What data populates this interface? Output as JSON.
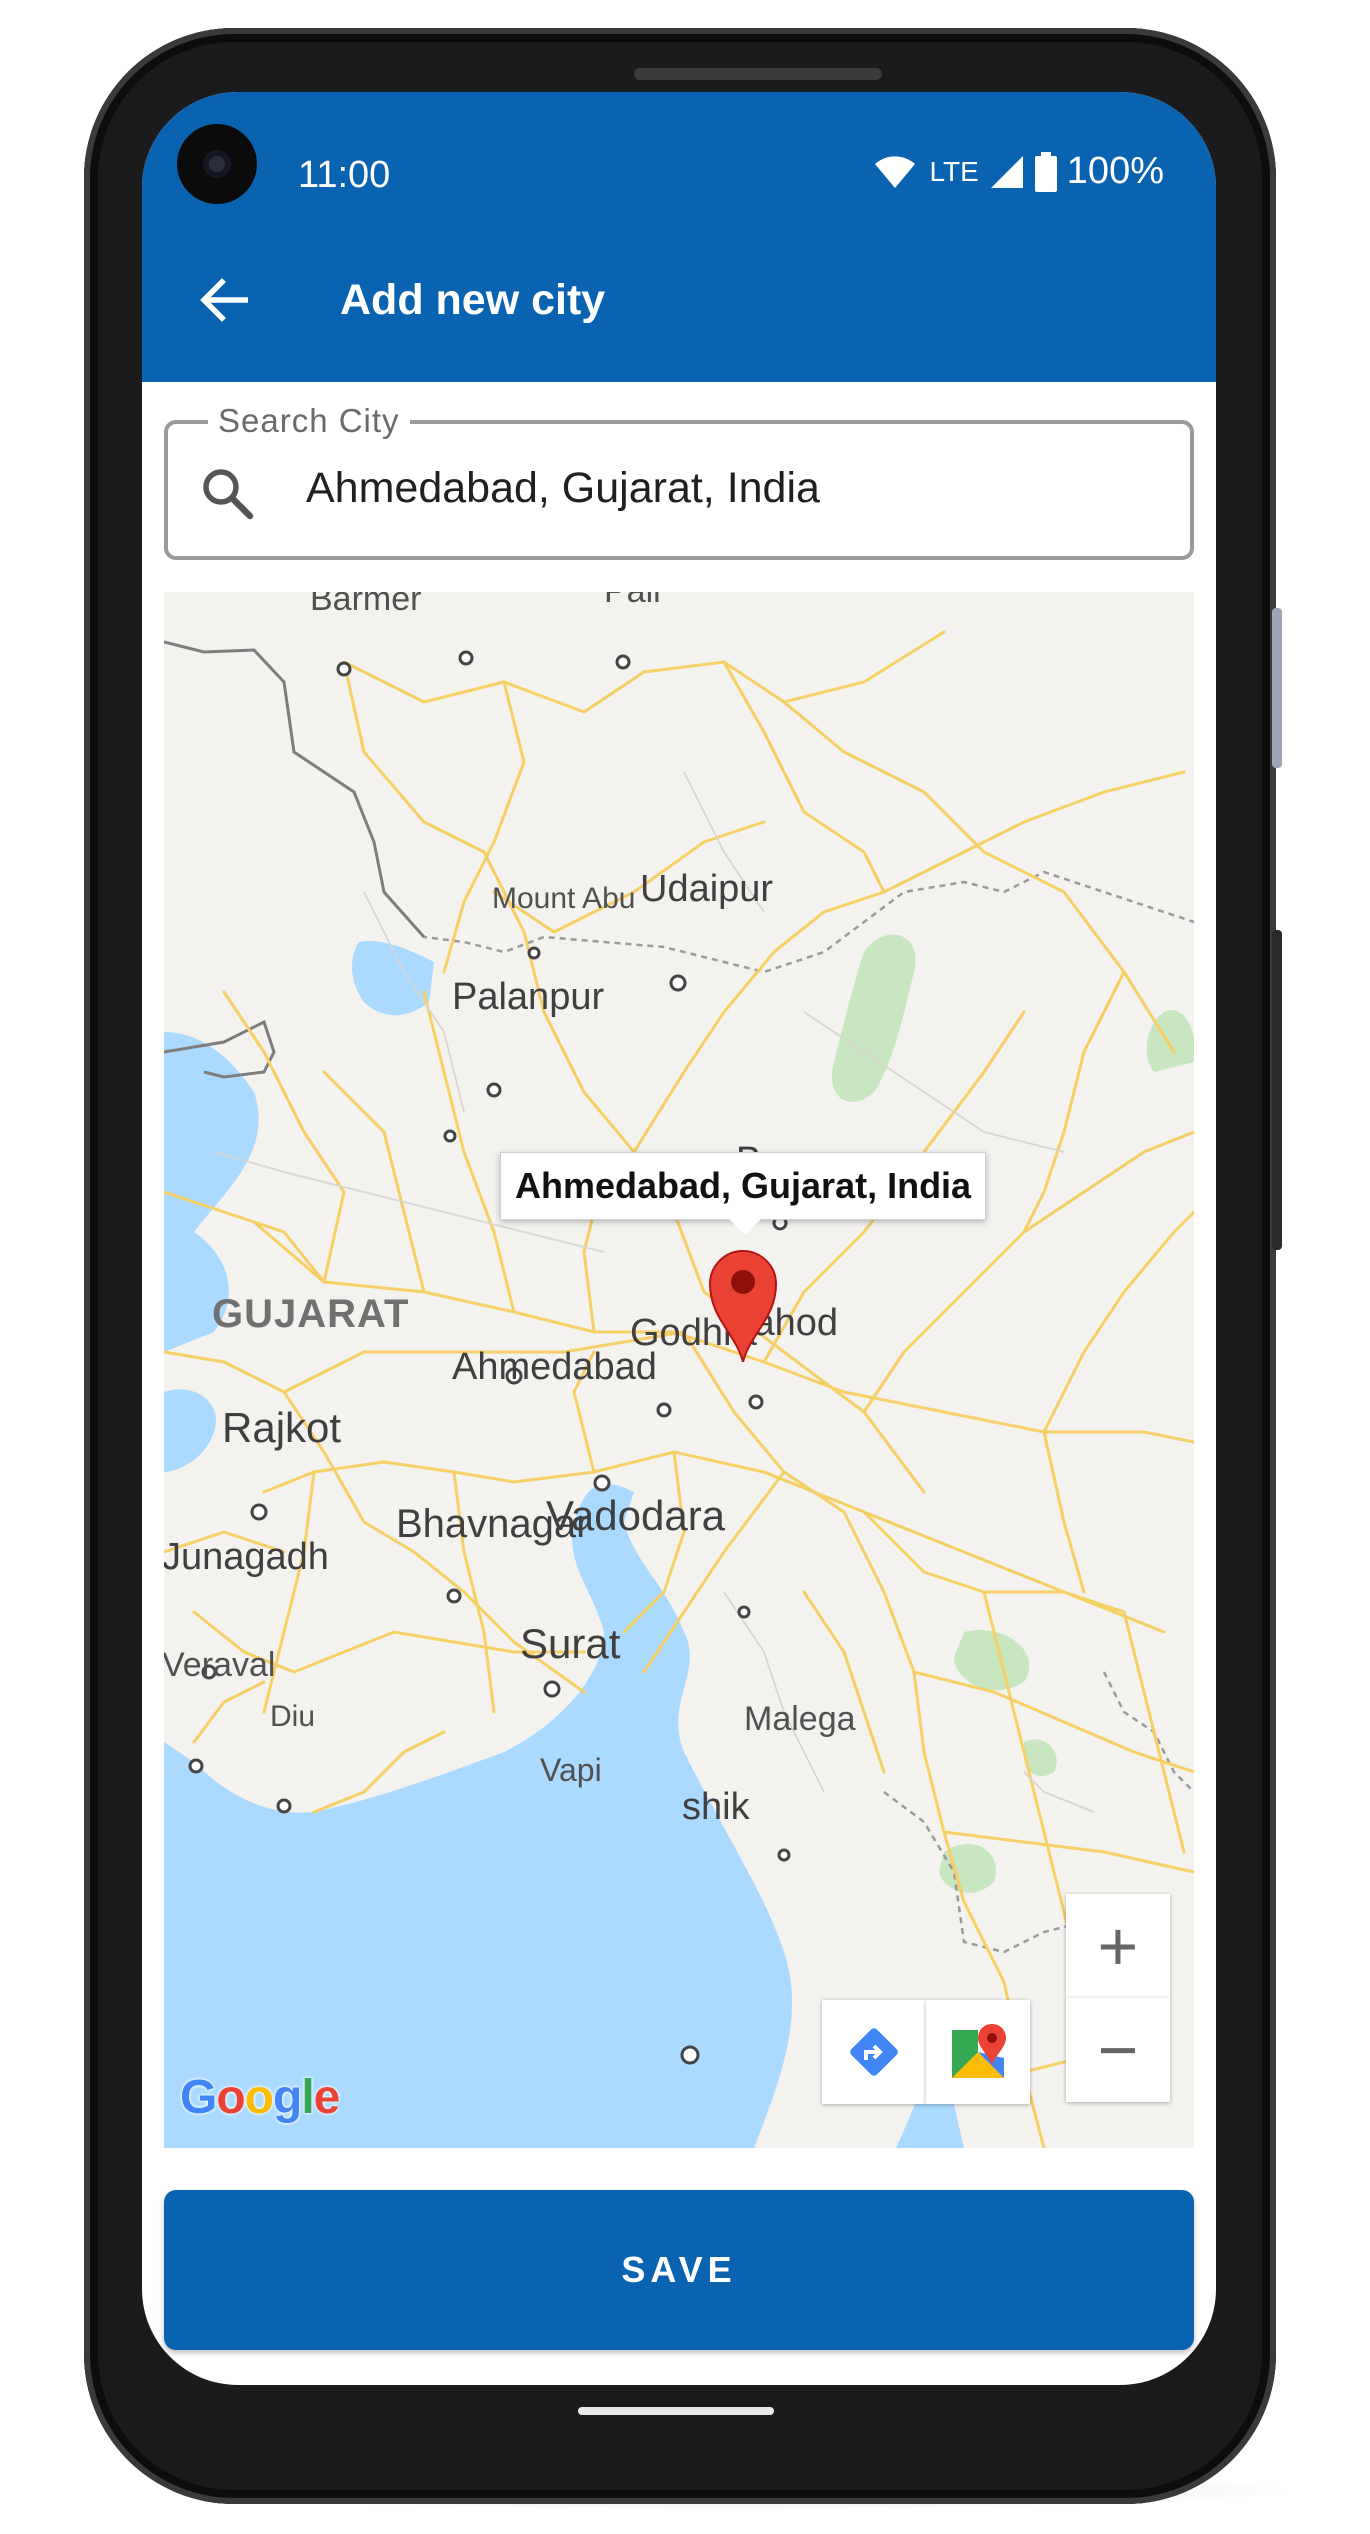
{
  "status_bar": {
    "time": "11:00",
    "network": "LTE",
    "battery": "100%"
  },
  "app_bar": {
    "title": "Add new city",
    "back_icon": "arrow-back-icon"
  },
  "search": {
    "label": "Search City",
    "value": "Ahmedabad, Gujarat, India",
    "icon": "search-icon"
  },
  "map": {
    "selected_place": "Ahmedabad, Gujarat, India",
    "attribution": "Google",
    "zoom_in_label": "+",
    "zoom_out_label": "−",
    "labels": {
      "barmer": "Barmer",
      "pali": "Pali",
      "mount_abu": "Mount Abu",
      "udaipur": "Udaipur",
      "palanpur": "Palanpur",
      "banswara": "Banswa",
      "gujarat": "GUJARAT",
      "godhra": "Godhra",
      "dahod": "Dahod",
      "ahmedabad": "Ahmedabad",
      "rajkot": "Rajkot",
      "bhavnagar": "Bhavnagar",
      "vadodara": "Vadodara",
      "junagadh": "Junagadh",
      "surat": "Surat",
      "veraval": "Veraval",
      "diu": "Diu",
      "malegaon": "Malega",
      "vapi": "Vapi",
      "nashik": "shik"
    },
    "colors": {
      "land": "#f3f2ef",
      "water": "#aadaff",
      "roads": "#f6cf65",
      "forest": "#c8e6c0",
      "pin": "#ea4335"
    }
  },
  "actions": {
    "save_label": "SAVE"
  },
  "colors": {
    "primary": "#0a63b0"
  }
}
